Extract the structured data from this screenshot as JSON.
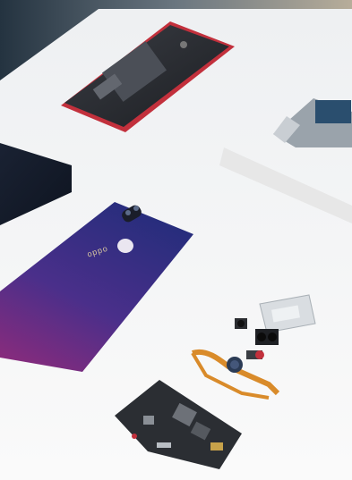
{
  "photo": {
    "logo_text": "oppo",
    "signature_text": "",
    "colors": {
      "table": "#f4f5f7",
      "backdrop": "#2d3b45",
      "back_cover_top": "#2a2f7a",
      "back_cover_bottom": "#7a2a7e",
      "frame_red": "#c2303c",
      "pcb": "#2b2e33",
      "flex_cable": "#d98b2a"
    }
  }
}
